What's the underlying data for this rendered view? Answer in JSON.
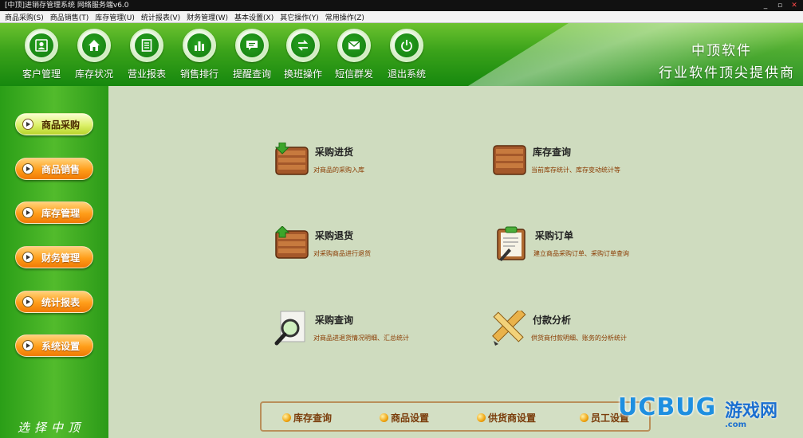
{
  "window": {
    "title": "[中顶]进销存管理系统 网络服务端v6.0",
    "controls": [
      "_",
      "▫",
      "✕"
    ]
  },
  "menubar": [
    "商品采购(S)",
    "商品销售(T)",
    "库存管理(U)",
    "统计报表(V)",
    "财务管理(W)",
    "基本设置(X)",
    "其它操作(Y)",
    "常用操作(Z)"
  ],
  "toolbar": {
    "items": [
      {
        "label": "客户管理",
        "icon": "customer-icon"
      },
      {
        "label": "库存状况",
        "icon": "home-icon"
      },
      {
        "label": "营业报表",
        "icon": "document-icon"
      },
      {
        "label": "销售排行",
        "icon": "bar-chart-icon"
      },
      {
        "label": "提醒查询",
        "icon": "message-icon"
      },
      {
        "label": "换班操作",
        "icon": "swap-icon"
      },
      {
        "label": "短信群发",
        "icon": "sms-icon"
      },
      {
        "label": "退出系统",
        "icon": "power-icon"
      }
    ],
    "brand_line1": "中顶软件",
    "brand_line2": "行业软件顶尖提供商"
  },
  "sidebar": {
    "items": [
      {
        "label": "商品采购",
        "active": true
      },
      {
        "label": "商品销售",
        "active": false
      },
      {
        "label": "库存管理",
        "active": false
      },
      {
        "label": "财务管理",
        "active": false
      },
      {
        "label": "统计报表",
        "active": false
      },
      {
        "label": "系统设置",
        "active": false
      }
    ],
    "slogan": "选择中顶"
  },
  "functions": [
    {
      "title": "采购进货",
      "desc": "对商品的采购入库",
      "icon": "crate-down-icon"
    },
    {
      "title": "库存查询",
      "desc": "当前库存统计、库存变动统计等",
      "icon": "crate-icon"
    },
    {
      "title": "采购退货",
      "desc": "对采购商品进行退货",
      "icon": "crate-up-icon"
    },
    {
      "title": "采购订单",
      "desc": "建立商品采购订单、采购订单查询",
      "icon": "clipboard-icon"
    },
    {
      "title": "采购查询",
      "desc": "对商品进退货情况明细、汇总统计",
      "icon": "magnifier-icon"
    },
    {
      "title": "付款分析",
      "desc": "供货商付款明细、账务的分析统计",
      "icon": "ruler-pencil-icon"
    }
  ],
  "quickbar": [
    "库存查询",
    "商品设置",
    "供货商设置",
    "员工设置"
  ],
  "watermark": {
    "logo": "UCBUG",
    "text": "游戏网",
    "domain": ".com"
  },
  "colors": {
    "toolbar_green": "#16880e",
    "content_bg": "#cfdcbf",
    "active_button": "#dcf06a",
    "sidebar_button": "#ff9d19",
    "desc_text": "#8a3a00"
  }
}
